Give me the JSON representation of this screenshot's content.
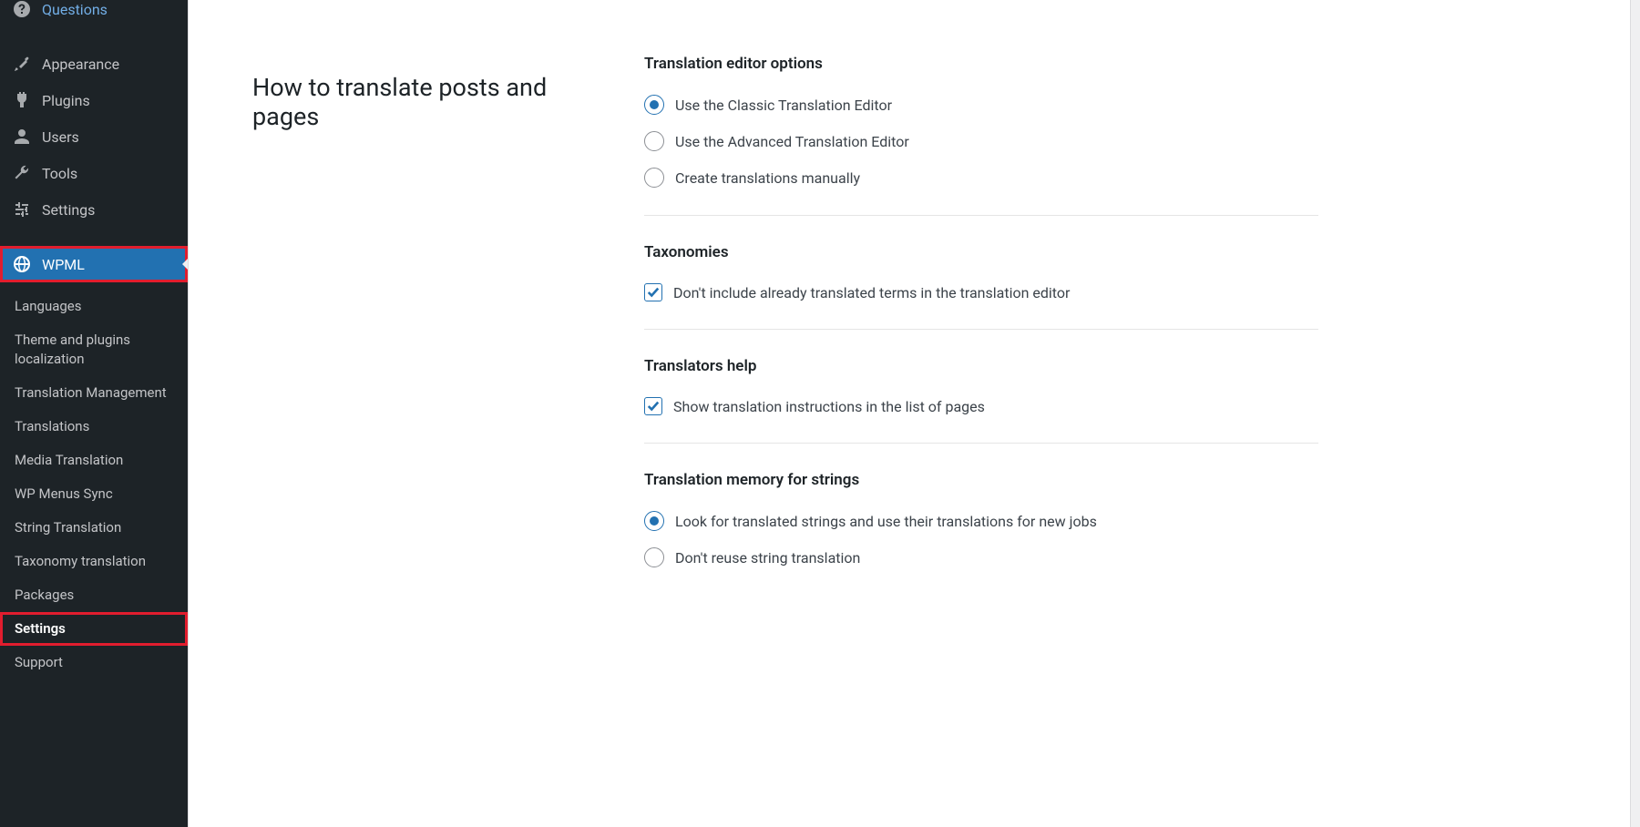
{
  "sidebar": {
    "top_items": [
      {
        "label": "Questions",
        "icon": "help"
      },
      {
        "label": "Appearance",
        "icon": "brush"
      },
      {
        "label": "Plugins",
        "icon": "plug"
      },
      {
        "label": "Users",
        "icon": "user"
      },
      {
        "label": "Tools",
        "icon": "wrench"
      },
      {
        "label": "Settings",
        "icon": "sliders"
      }
    ],
    "active_item": {
      "label": "WPML",
      "icon": "globe"
    },
    "submenu": [
      {
        "label": "Languages"
      },
      {
        "label": "Theme and plugins localization"
      },
      {
        "label": "Translation Management"
      },
      {
        "label": "Translations"
      },
      {
        "label": "Media Translation"
      },
      {
        "label": "WP Menus Sync"
      },
      {
        "label": "String Translation"
      },
      {
        "label": "Taxonomy translation"
      },
      {
        "label": "Packages"
      },
      {
        "label": "Settings",
        "current": true
      },
      {
        "label": "Support"
      }
    ]
  },
  "page": {
    "heading": "How to translate posts and pages",
    "sections": [
      {
        "title": "Translation editor options",
        "type": "radio",
        "options": [
          {
            "label": "Use the Classic Translation Editor",
            "selected": true
          },
          {
            "label": "Use the Advanced Translation Editor",
            "selected": false
          },
          {
            "label": "Create translations manually",
            "selected": false
          }
        ]
      },
      {
        "title": "Taxonomies",
        "type": "checkbox",
        "options": [
          {
            "label": "Don't include already translated terms in the translation editor",
            "checked": true
          }
        ]
      },
      {
        "title": "Translators help",
        "type": "checkbox",
        "options": [
          {
            "label": "Show translation instructions in the list of pages",
            "checked": true
          }
        ]
      },
      {
        "title": "Translation memory for strings",
        "type": "radio",
        "options": [
          {
            "label": "Look for translated strings and use their translations for new jobs",
            "selected": true
          },
          {
            "label": "Don't reuse string translation",
            "selected": false
          }
        ]
      }
    ]
  }
}
